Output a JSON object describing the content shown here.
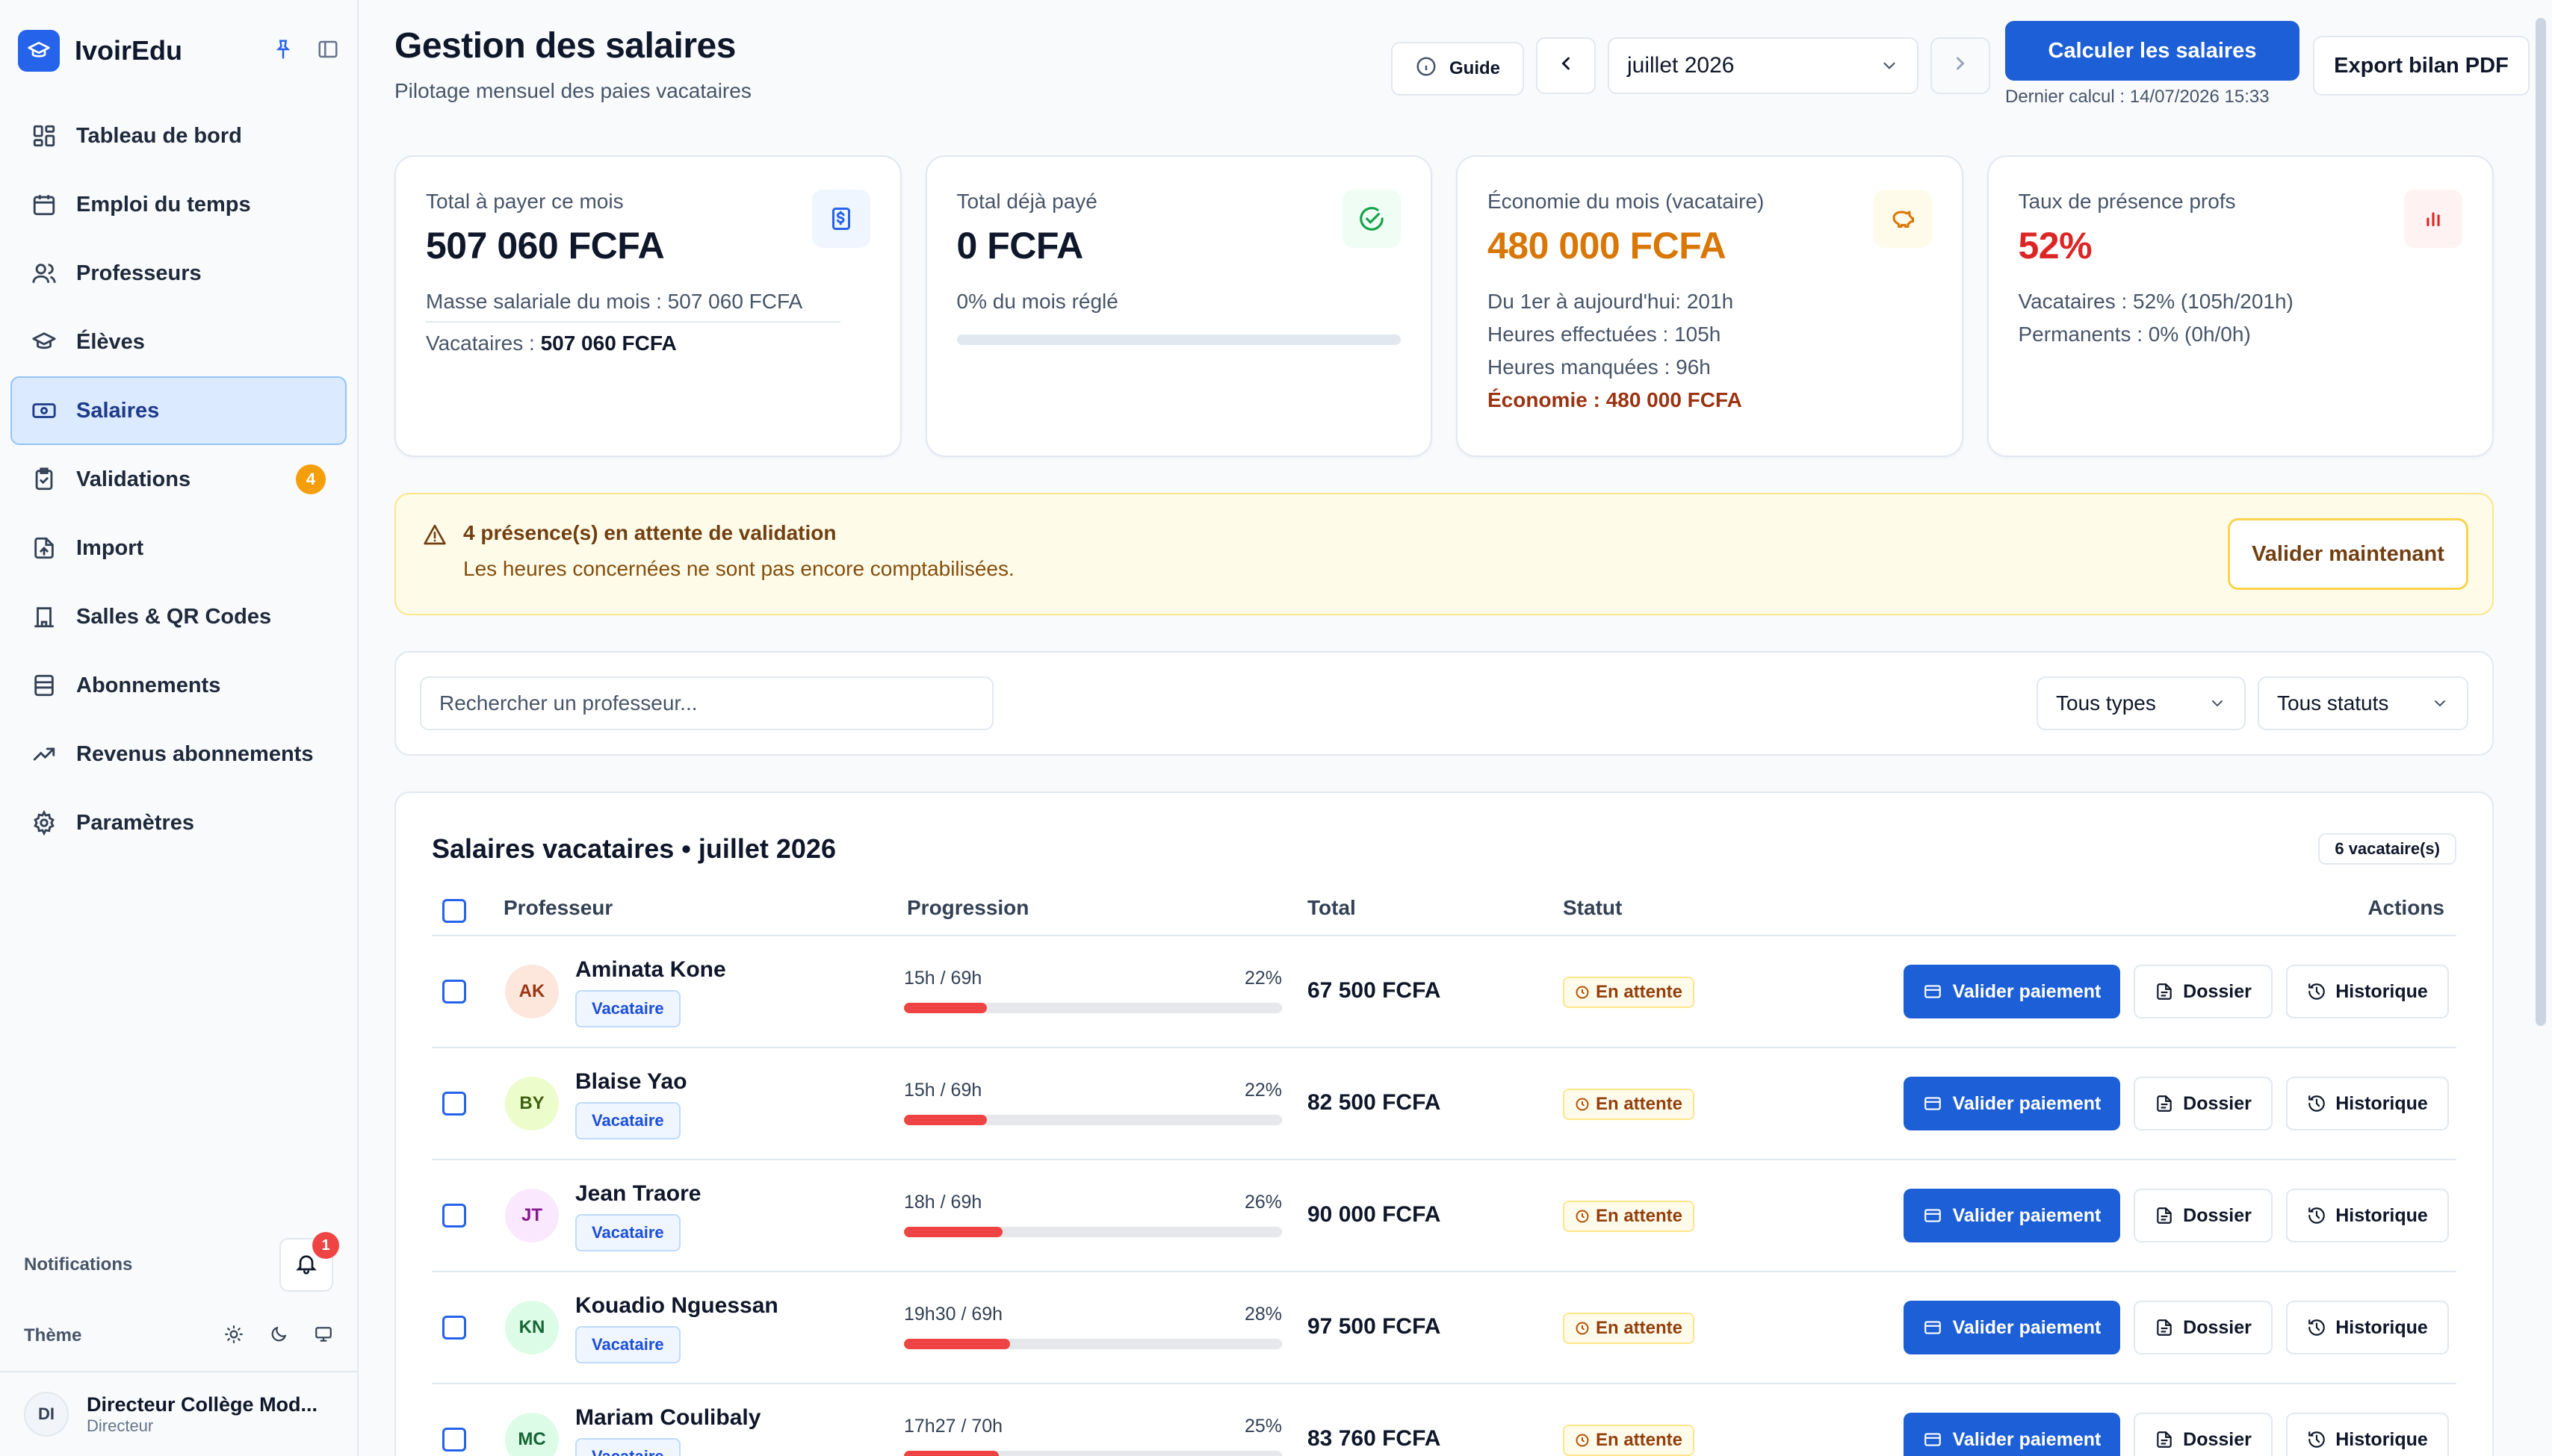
{
  "app": {
    "name": "IvoirEdu"
  },
  "sidebar": {
    "items": [
      {
        "label": "Tableau de bord",
        "icon": "dashboard-icon"
      },
      {
        "label": "Emploi du temps",
        "icon": "calendar-icon"
      },
      {
        "label": "Professeurs",
        "icon": "users-icon"
      },
      {
        "label": "Élèves",
        "icon": "graduation-cap-icon"
      },
      {
        "label": "Salaires",
        "icon": "banknote-icon",
        "active": true
      },
      {
        "label": "Validations",
        "icon": "clipboard-check-icon",
        "badge": "4"
      },
      {
        "label": "Import",
        "icon": "file-import-icon"
      },
      {
        "label": "Salles & QR Codes",
        "icon": "building-icon"
      },
      {
        "label": "Abonnements",
        "icon": "archive-icon"
      },
      {
        "label": "Revenus abonnements",
        "icon": "trending-up-icon"
      },
      {
        "label": "Paramètres",
        "icon": "gear-icon"
      }
    ],
    "notifications_label": "Notifications",
    "notifications_count": "1",
    "theme_label": "Thème",
    "user": {
      "initials": "DI",
      "name": "Directeur Collège Mod...",
      "role": "Directeur"
    }
  },
  "header": {
    "title": "Gestion des salaires",
    "subtitle": "Pilotage mensuel des paies vacataires",
    "guide_label": "Guide",
    "month": "juillet 2026",
    "calc_label": "Calculer les salaires",
    "last_calc": "Dernier calcul : 14/07/2026 15:33",
    "export_label": "Export bilan PDF"
  },
  "cards": {
    "total_to_pay": {
      "label": "Total à payer ce mois",
      "value": "507 060 FCFA",
      "line1": "Masse salariale du mois : 507 060 FCFA",
      "line2_label": "Vacataires : ",
      "line2_value": "507 060 FCFA"
    },
    "total_paid": {
      "label": "Total déjà payé",
      "value": "0 FCFA",
      "line1": "0% du mois réglé",
      "progress": 0
    },
    "savings": {
      "label": "Économie du mois (vacataire)",
      "value": "480 000 FCFA",
      "line1": "Du 1er à aujourd'hui: 201h",
      "line2": "Heures effectuées : 105h",
      "line3": "Heures manquées : 96h",
      "line4": "Économie : 480 000 FCFA"
    },
    "presence": {
      "label": "Taux de présence profs",
      "value": "52%",
      "line1": "Vacataires : 52% (105h/201h)",
      "line2": "Permanents : 0% (0h/0h)"
    }
  },
  "alert": {
    "title": "4 présence(s) en attente de validation",
    "text": "Les heures concernées ne sont pas encore comptabilisées.",
    "button": "Valider maintenant"
  },
  "filters": {
    "search_placeholder": "Rechercher un professeur...",
    "type_select": "Tous types",
    "status_select": "Tous statuts"
  },
  "table": {
    "title": "Salaires vacataires • juillet 2026",
    "count": "6 vacataire(s)",
    "columns": {
      "teacher": "Professeur",
      "progress": "Progression",
      "total": "Total",
      "status": "Statut",
      "actions": "Actions"
    },
    "action_labels": {
      "validate": "Valider paiement",
      "file": "Dossier",
      "history": "Historique"
    },
    "rows": [
      {
        "initials": "AK",
        "name": "Aminata Kone",
        "tag": "Vacataire",
        "hours": "15h / 69h",
        "percent": "22%",
        "progress": 0.22,
        "total": "67 500 FCFA",
        "status": "En attente",
        "avatar_bg": "#fde7dc",
        "avatar_fg": "#9a3412"
      },
      {
        "initials": "BY",
        "name": "Blaise Yao",
        "tag": "Vacataire",
        "hours": "15h / 69h",
        "percent": "22%",
        "progress": 0.22,
        "total": "82 500 FCFA",
        "status": "En attente",
        "avatar_bg": "#ecfccb",
        "avatar_fg": "#3f6212"
      },
      {
        "initials": "JT",
        "name": "Jean Traore",
        "tag": "Vacataire",
        "hours": "18h / 69h",
        "percent": "26%",
        "progress": 0.26,
        "total": "90 000 FCFA",
        "status": "En attente",
        "avatar_bg": "#fae8ff",
        "avatar_fg": "#86198f"
      },
      {
        "initials": "KN",
        "name": "Kouadio Nguessan",
        "tag": "Vacataire",
        "hours": "19h30 / 69h",
        "percent": "28%",
        "progress": 0.28,
        "total": "97 500 FCFA",
        "status": "En attente",
        "avatar_bg": "#dcfce7",
        "avatar_fg": "#166534"
      },
      {
        "initials": "MC",
        "name": "Mariam Coulibaly",
        "tag": "Vacataire",
        "hours": "17h27 / 70h",
        "percent": "25%",
        "progress": 0.25,
        "total": "83 760 FCFA",
        "status": "En attente",
        "avatar_bg": "#dcfce7",
        "avatar_fg": "#166534"
      }
    ]
  },
  "colors": {
    "accent": "#1d5fd6",
    "warning": "#f59e0b",
    "danger": "#ef4444",
    "savings": "#d97706"
  }
}
